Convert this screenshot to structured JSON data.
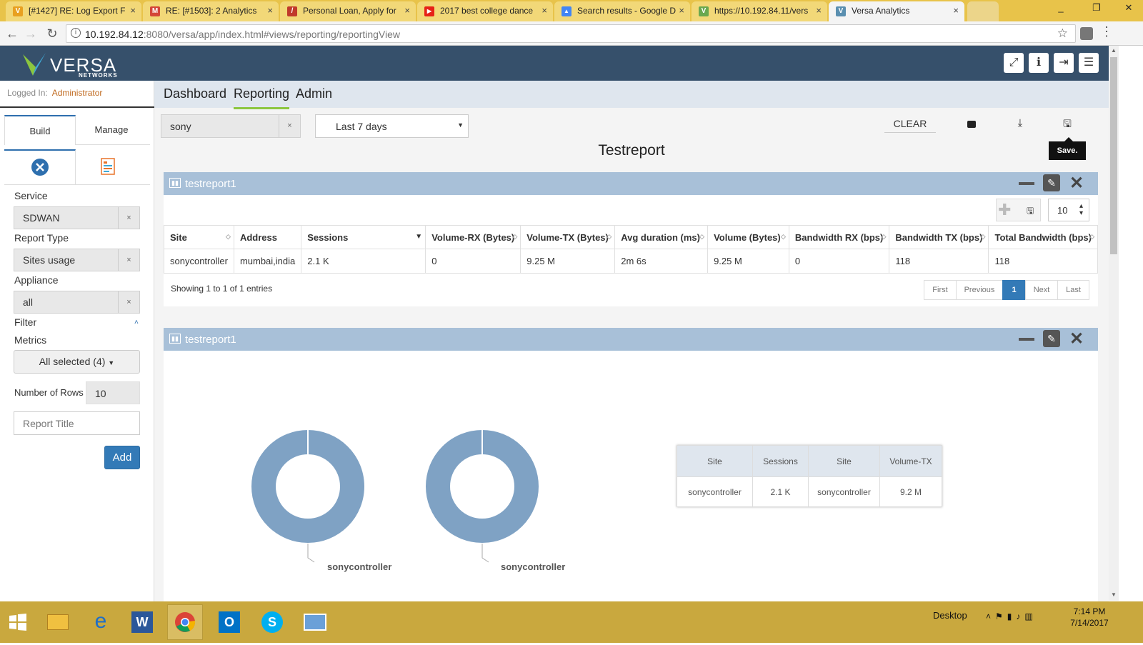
{
  "browser": {
    "tabs": [
      {
        "title": "[#1427] RE: Log Export F",
        "fav_color": "#e8a020",
        "fav_glyph": "V"
      },
      {
        "title": "RE: [#1503]: 2 Analytics",
        "fav_color": "#d44638",
        "fav_glyph": "M"
      },
      {
        "title": "Personal Loan, Apply for",
        "fav_color": "#c0392b",
        "fav_glyph": "/"
      },
      {
        "title": "2017 best college dance",
        "fav_color": "#e62117",
        "fav_glyph": "▶"
      },
      {
        "title": "Search results - Google D",
        "fav_color": "#4285f4",
        "fav_glyph": "▲"
      },
      {
        "title": "https://10.192.84.11/vers",
        "fav_color": "#6aa84f",
        "fav_glyph": "V"
      },
      {
        "title": "Versa Analytics",
        "fav_color": "#5a8fb0",
        "fav_glyph": "V"
      }
    ],
    "url_host": "10.192.84.12",
    "url_rest": ":8080/versa/app/index.html#views/reporting/reportingView",
    "window_buttons": [
      "_",
      "❐",
      "✕"
    ]
  },
  "header": {
    "logo": "VERSA",
    "logo_sub": "NETWORKS",
    "buttons": [
      {
        "name": "fullscreen-icon",
        "glyph": "⤢"
      },
      {
        "name": "info-icon",
        "glyph": "ℹ"
      },
      {
        "name": "logout-icon",
        "glyph": "⇥"
      },
      {
        "name": "menu-icon",
        "glyph": "☰"
      }
    ]
  },
  "sidebar": {
    "logged_label": "Logged In:",
    "logged_user": "Administrator",
    "tabs": [
      "Build",
      "Manage"
    ],
    "service_label": "Service",
    "service_value": "SDWAN",
    "report_type_label": "Report Type",
    "report_type_value": "Sites usage",
    "appliance_label": "Appliance",
    "appliance_value": "all",
    "filter_label": "Filter",
    "metrics_label": "Metrics",
    "metrics_value": "All selected (4)",
    "rows_label": "Number of Rows",
    "rows_value": "10",
    "title_placeholder": "Report Title",
    "add_label": "Add",
    "clear_x": "×"
  },
  "main": {
    "nav": [
      "Dashboard",
      "Reporting",
      "Admin"
    ],
    "search_value": "sony",
    "time_range": "Last 7 days",
    "clear_label": "CLEAR",
    "save_tooltip": "Save.",
    "report_title": "Testreport",
    "panel1_title": "testreport1",
    "panel2_title": "testreport1",
    "page_size": "10",
    "table": {
      "columns": [
        "Site",
        "Address",
        "Sessions",
        "Volume-RX (Bytes)",
        "Volume-TX (Bytes)",
        "Avg duration (ms)",
        "Volume (Bytes)",
        "Bandwidth RX (bps)",
        "Bandwidth TX (bps)",
        "Total Bandwidth (bps)"
      ],
      "rows": [
        [
          "sonycontroller",
          "mumbai,india",
          "2.1 K",
          "0",
          "9.25 M",
          "2m 6s",
          "9.25 M",
          "0",
          "118",
          "118"
        ]
      ]
    },
    "entries_text": "Showing 1 to 1 of 1 entries",
    "pagination": [
      "First",
      "Previous",
      "1",
      "Next",
      "Last"
    ],
    "donut_labels": [
      "sonycontroller",
      "sonycontroller"
    ],
    "summary_table": {
      "columns": [
        "Site",
        "Sessions",
        "Site",
        "Volume-TX"
      ],
      "rows": [
        [
          "sonycontroller",
          "2.1 K",
          "sonycontroller",
          "9.2 M"
        ]
      ]
    },
    "donut_color": "#7fa2c4"
  },
  "taskbar": {
    "desktop_label": "Desktop",
    "time": "7:14 PM",
    "date": "7/14/2017"
  }
}
